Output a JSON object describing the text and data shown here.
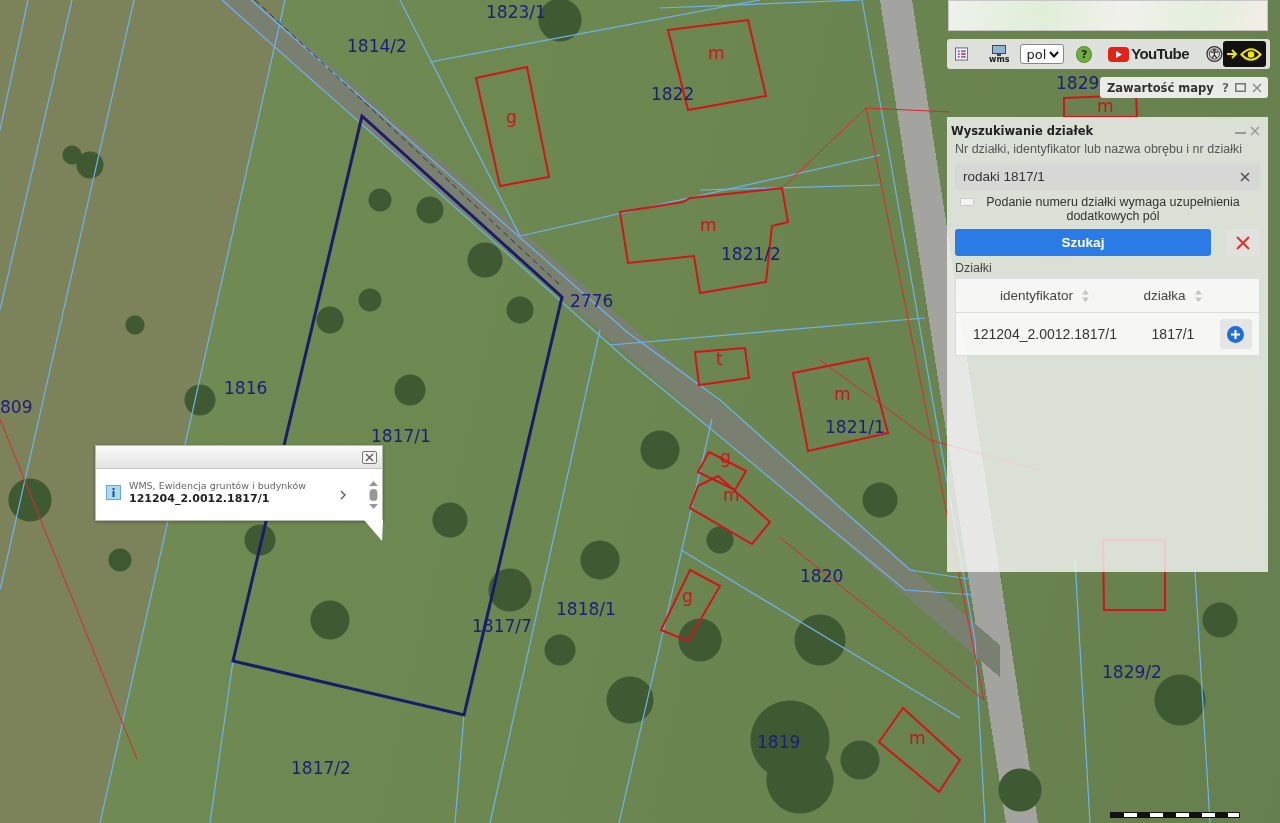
{
  "map": {
    "parcel_labels": [
      "1823/1",
      "1814/2",
      "1822",
      "1829",
      "2776",
      "1816",
      "809",
      "1817/1",
      "1821/2",
      "1821/1",
      "1820",
      "1818/1",
      "1817/7",
      "1829/2",
      "1819",
      "1817/2"
    ],
    "building_labels": [
      "g",
      "m",
      "m",
      "t",
      "m",
      "g",
      "m",
      "g",
      "m",
      "m"
    ]
  },
  "toolbar": {
    "wms_label": "wms",
    "language": "pol",
    "help": "?",
    "video_label": "YouTube",
    "high_contrast": {
      "on": false
    }
  },
  "map_contents": {
    "title": "Zawartość mapy",
    "help": "?"
  },
  "parcel_search": {
    "title": "Wyszukiwanie działek",
    "field_label": "Nr działki, identyfikator lub nazwa obrębu i nr działki",
    "query": "rodaki 1817/1",
    "hint": "Podanie numeru działki wymaga uzupełnienia dodatkowych pól",
    "search_button": "Szukaj",
    "results_label": "Działki",
    "table": {
      "columns": [
        "identyfikator",
        "działka"
      ],
      "rows": [
        {
          "cells": [
            "121204_2.0012.1817/1",
            "1817/1"
          ]
        }
      ]
    }
  },
  "info_popup": {
    "source": "WMS, Ewidencja gruntów i budynków",
    "feature_id": "121204_2.0012.1817/1"
  }
}
